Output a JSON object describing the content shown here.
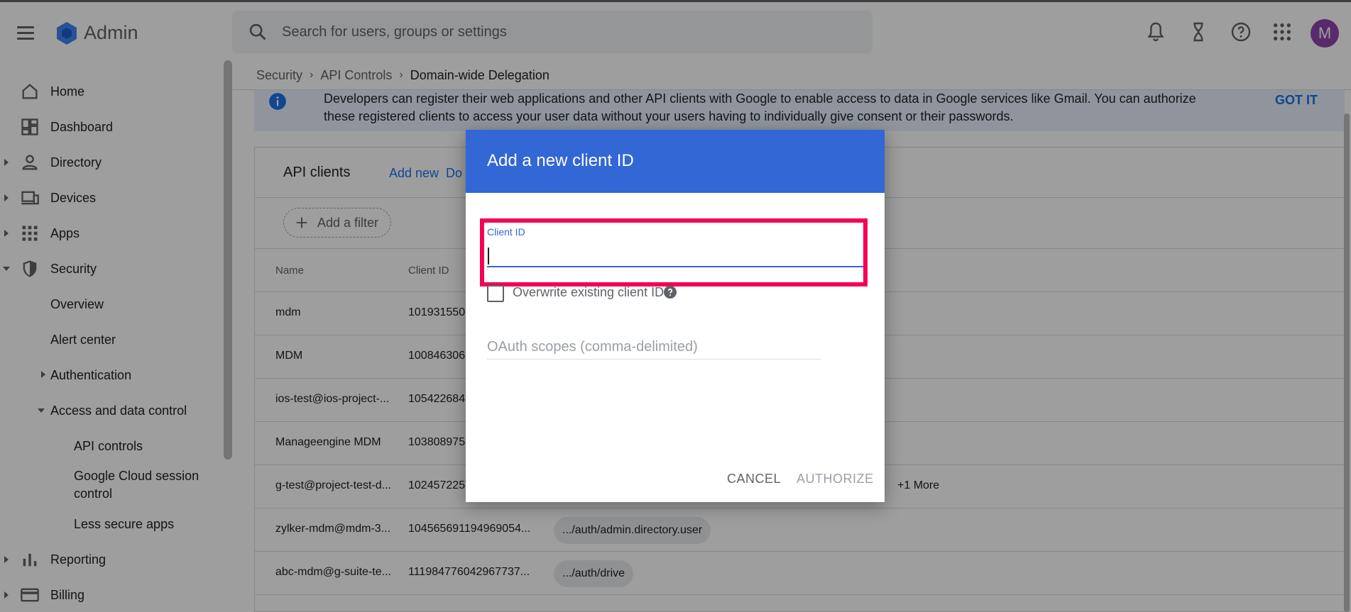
{
  "app": {
    "title": "Admin",
    "avatar_initial": "M"
  },
  "search": {
    "placeholder": "Search for users, groups or settings"
  },
  "sidebar": {
    "items": [
      {
        "label": "Home",
        "icon": "home-icon"
      },
      {
        "label": "Dashboard",
        "icon": "dashboard-icon"
      },
      {
        "label": "Directory",
        "icon": "person-icon"
      },
      {
        "label": "Devices",
        "icon": "devices-icon"
      },
      {
        "label": "Apps",
        "icon": "apps-grid-icon"
      },
      {
        "label": "Security",
        "icon": "shield-icon"
      }
    ],
    "security_sub": [
      "Overview",
      "Alert center",
      "Authentication",
      "Access and data control"
    ],
    "access_sub": [
      "API controls",
      "Google Cloud session",
      "control",
      "Less secure apps"
    ],
    "bottom_items": [
      {
        "label": "Reporting",
        "icon": "bar-chart-icon"
      },
      {
        "label": "Billing",
        "icon": "credit-card-icon"
      }
    ]
  },
  "breadcrumb": [
    "Security",
    "API Controls",
    "Domain-wide Delegation"
  ],
  "banner": {
    "text": "Developers can register their web applications and other API clients with Google to enable access to data in Google services like Gmail. You can authorize these registered clients to access your user data without your users having to individually give consent or their passwords.",
    "dismiss": "GOT IT"
  },
  "card": {
    "title": "API clients",
    "add_new": "Add new",
    "partial_action": "Do",
    "filter": "Add a filter",
    "columns": [
      "Name",
      "Client ID"
    ],
    "rows": [
      {
        "name": "mdm",
        "client_id": "101931550",
        "scope": ""
      },
      {
        "name": "MDM",
        "client_id": "100846306",
        "scope": ""
      },
      {
        "name": "ios-test@ios-project-...",
        "client_id": "105422684",
        "scope": ""
      },
      {
        "name": "Manageengine MDM",
        "client_id": "103808975",
        "scope": ""
      },
      {
        "name": "g-test@project-test-d...",
        "client_id": "102457225",
        "scope": "",
        "more": "+1 More"
      },
      {
        "name": "zylker-mdm@mdm-3...",
        "client_id": "104565691194969054...",
        "scope": ".../auth/admin.directory.user"
      },
      {
        "name": "abc-mdm@g-suite-te...",
        "client_id": "111984776042967737...",
        "scope": ".../auth/drive"
      }
    ]
  },
  "dialog": {
    "title": "Add a new client ID",
    "client_id_label": "Client ID",
    "client_id_value": "",
    "overwrite_label": "Overwrite existing client ID",
    "scopes_placeholder": "OAuth scopes (comma-delimited)",
    "cancel": "CANCEL",
    "authorize": "AUTHORIZE"
  },
  "colors": {
    "accent": "#3367d6",
    "highlight": "#f50057",
    "avatar": "#8e44ad"
  }
}
